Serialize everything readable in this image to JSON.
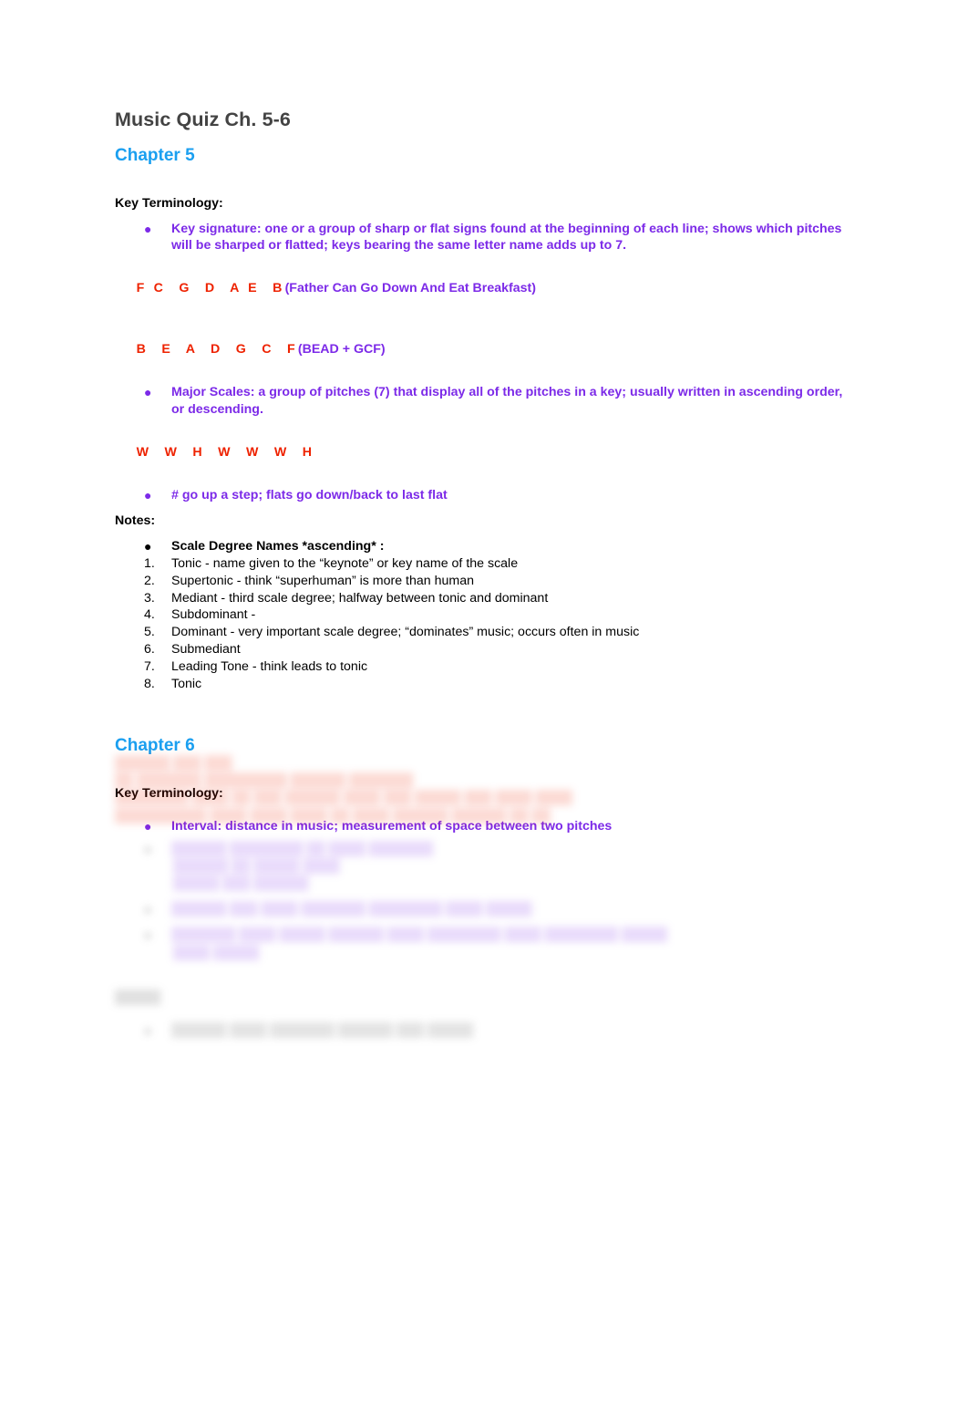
{
  "document": {
    "title": "Music Quiz Ch. 5-6"
  },
  "chapter5": {
    "heading": "Chapter 5",
    "key_terminology_label": "Key Terminology:",
    "bullets": [
      {
        "text": "Key signature: one or a group of sharp or flat signs found at the beginning of each line; shows which pitches will be sharped or flatted; keys bearing the same letter name adds up to 7.",
        "color": "purple"
      },
      {
        "text": "Major Scales: a group of pitches (7) that display all of the pitches in a key; usually written in ascending order, or descending.",
        "color": "purple"
      },
      {
        "text": "# go up a step; flats go down/back to last flat",
        "color": "purple"
      }
    ],
    "mnemonic_sharps": {
      "letters": "F C  G  D  A E  B",
      "expansion": "(Father Can Go Down And Eat Breakfast)"
    },
    "mnemonic_flats": {
      "letters": "B  E  A  D  G  C  F",
      "expansion": "(BEAD + GCF)"
    },
    "whole_half_pattern": "W  W  H  W  W  W  H",
    "notes_label": "Notes:",
    "scale_degree_heading": "Scale Degree Names *ascending* :",
    "scale_degrees": [
      {
        "n": "1.",
        "text": "Tonic - name given to the “keynote” or key name of the scale"
      },
      {
        "n": "2.",
        "text": "Supertonic - think “superhuman” is more than human"
      },
      {
        "n": "3.",
        "text": "Mediant - third scale degree; halfway between tonic and dominant"
      },
      {
        "n": "4.",
        "text": "Subdominant -"
      },
      {
        "n": "5.",
        "text": "Dominant - very important scale degree; “dominates” music; occurs often in music"
      },
      {
        "n": "6.",
        "text": "Submediant"
      },
      {
        "n": "7.",
        "text": "Leading Tone - think leads to tonic"
      },
      {
        "n": "8.",
        "text": "Tonic"
      }
    ]
  },
  "chapter6": {
    "heading": "Chapter 6",
    "key_terminology_label": "Key Terminology:",
    "bullets": [
      {
        "text": "Interval: distance in music; measurement of space between two pitches",
        "color": "purple"
      }
    ]
  },
  "obscured": {
    "note": "illegible",
    "red_block": [
      "██████ ███ ███",
      "██ ███████ █████████ ██████ ███████",
      "████████ ████ ██ ███ ██████ ████ ███ █████ ███ ████ ████",
      "██████████ ████ ████ ████ ██ ████ ██████ ██████ ██ ██"
    ],
    "purple_block": [
      "██████ ████████ ██ ████ ███████",
      "██████ ██ █████ ████",
      "█████ ███ ██████",
      "██████ ███ ████ ███████ ████████ ████ █████",
      "███████ ████ █████ ██████ ████ ████████ ████ ████████ █████",
      "████ █████"
    ],
    "gray_block": [
      "█████",
      "██████ ████ ███████ ██████ ███ █████"
    ]
  },
  "icons": {
    "bullet": "●",
    "bullet_small": "●"
  }
}
